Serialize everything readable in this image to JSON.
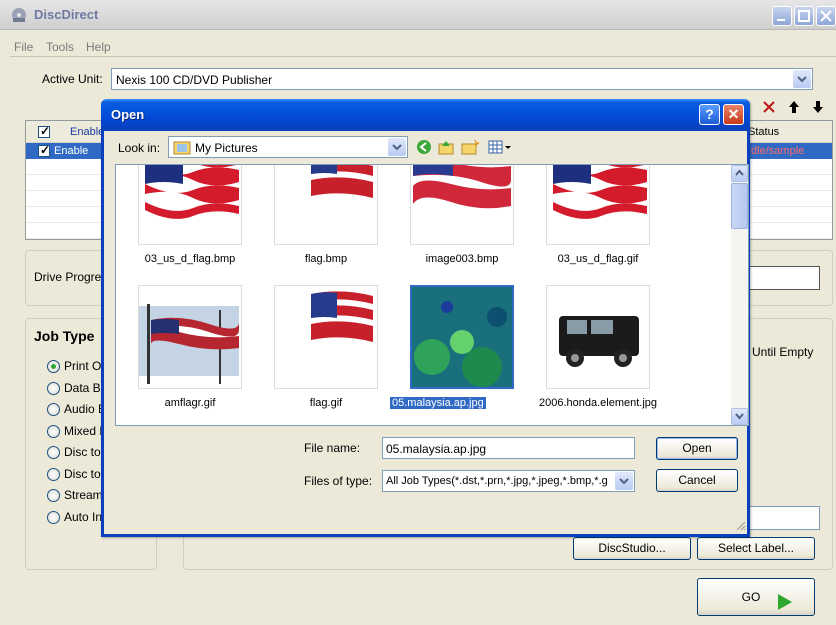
{
  "app": {
    "title": "DiscDirect",
    "menu": [
      "File",
      "Tools",
      "Help"
    ]
  },
  "main": {
    "active_unit_label": "Active Unit:",
    "active_unit_value": "Nexis 100 CD/DVD Publisher",
    "table": {
      "header_check": "Enabled",
      "header_status": "Status",
      "row_check": "Enable",
      "row_status": "Idle/sample"
    },
    "drive_progress_label": "Drive Progress",
    "job_type": {
      "title": "Job Type",
      "options": [
        "Print Only",
        "Data Burn",
        "Audio Burn",
        "Mixed Burn",
        "Disc to Image",
        "Disc to Disc",
        "Streaming",
        "Auto Insert"
      ],
      "selected_index": 0
    },
    "until_empty_label": "Until Empty",
    "discstudio_label": "DiscStudio...",
    "select_label_label": "Select Label...",
    "go_label": "GO"
  },
  "dialog": {
    "title": "Open",
    "help_btn": "?",
    "close_btn": "✕",
    "look_in_label": "Look in:",
    "look_in_value": "My Pictures",
    "files": [
      {
        "name": "03_us_d_flag.bmp",
        "kind": "flag-wave"
      },
      {
        "name": "flag.bmp",
        "kind": "flag-small"
      },
      {
        "name": "image003.bmp",
        "kind": "flag-wide"
      },
      {
        "name": "03_us_d_flag.gif",
        "kind": "flag-wave"
      },
      {
        "name": "amflagr.gif",
        "kind": "flag-ship"
      },
      {
        "name": "flag.gif",
        "kind": "flag-small"
      },
      {
        "name": "05.malaysia.ap.jpg",
        "kind": "underwater",
        "selected": true
      },
      {
        "name": "2006.honda.element.jpg",
        "kind": "car"
      }
    ],
    "file_name_label": "File name:",
    "file_name_value": "05.malaysia.ap.jpg",
    "files_of_type_label": "Files of type:",
    "files_of_type_value": "All Job Types(*.dst,*.prn,*.jpg,*.jpeg,*.bmp,*.g",
    "open_label": "Open",
    "cancel_label": "Cancel"
  },
  "colors": {
    "selection": "#316ac5",
    "dialog_title": "#0348d6",
    "go_arrow": "#2fa82f"
  }
}
